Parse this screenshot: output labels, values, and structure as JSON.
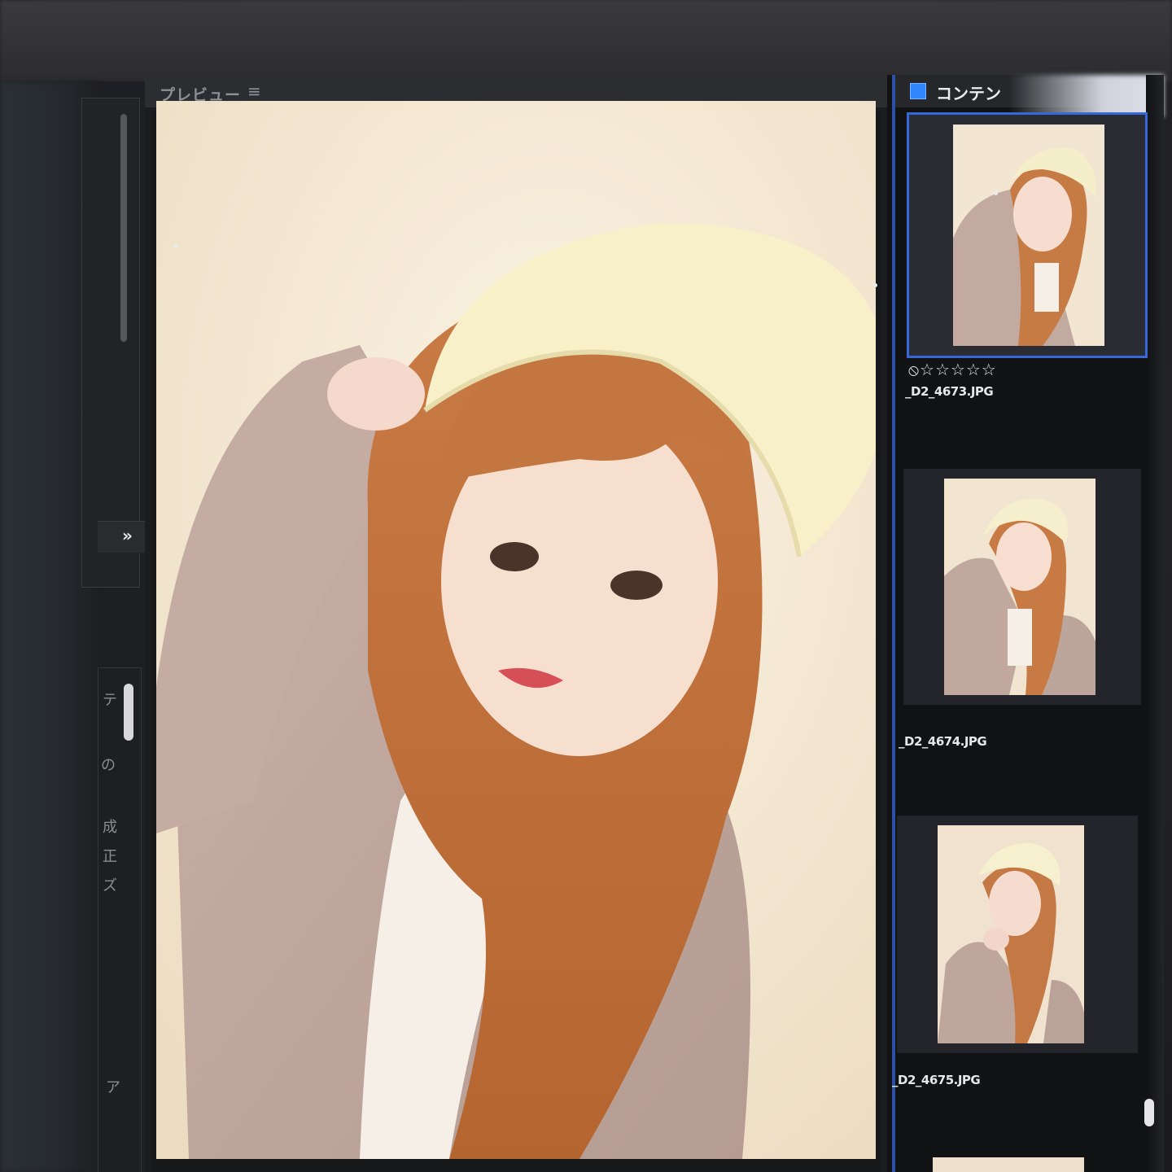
{
  "preview": {
    "title": "プレビュー",
    "menu_icon": "hamburger-menu-icon"
  },
  "content_panel": {
    "title": "コンテン",
    "thumbnails": [
      {
        "file": "_D2_4673.JPG",
        "rating": 0,
        "selected": true,
        "reject_icon": "⦸",
        "stars": "☆☆☆☆☆"
      },
      {
        "file": "_D2_4674.JPG",
        "rating": 0,
        "selected": false
      },
      {
        "file": "_D2_4675.JPG",
        "rating": 0,
        "selected": false
      }
    ]
  },
  "left_panel": {
    "expand_icon": "»",
    "glyphs": [
      "の",
      "成",
      "正",
      "ズ",
      "テ",
      "ア"
    ]
  },
  "colors": {
    "accent": "#2f86ff",
    "selection_border": "#3a67d8",
    "panel_bg": "#1b1c1f"
  }
}
